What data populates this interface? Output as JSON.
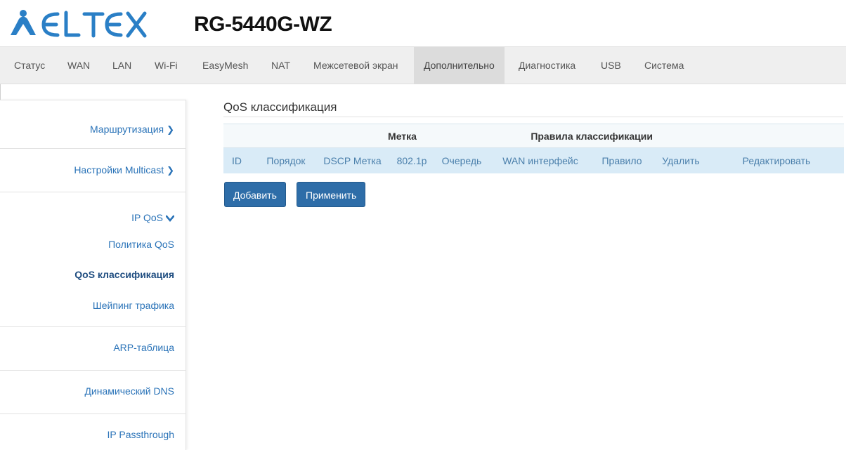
{
  "header": {
    "logo_text": "ELTEX",
    "model": "RG-5440G-WZ",
    "brand_color": "#2a7fc6"
  },
  "topnav": {
    "items": [
      "Статус",
      "WAN",
      "LAN",
      "Wi-Fi",
      "EasyMesh",
      "NAT",
      "Межсетевой экран",
      "Дополнительно",
      "Диагностика",
      "USB",
      "Система"
    ],
    "active": "Дополнительно"
  },
  "sidebar": {
    "items": [
      {
        "label": "Маршрутизация",
        "icon": "chevron-right-icon"
      },
      {
        "label": "Настройки Multicast",
        "icon": "chevron-right-icon"
      },
      {
        "label": "IP QoS",
        "icon": "chevron-down-icon"
      },
      {
        "label": "Политика QoS"
      },
      {
        "label": "QoS классификация",
        "active": true
      },
      {
        "label": "Шейпинг трафика"
      },
      {
        "label": "ARP-таблица"
      },
      {
        "label": "Динамический DNS"
      },
      {
        "label": "IP Passthrough"
      }
    ]
  },
  "main": {
    "title": "QoS классификация",
    "table": {
      "group_headers": [
        "Метка",
        "Правила классификации"
      ],
      "columns": [
        "ID",
        "Порядок",
        "DSCP Метка",
        "802.1p",
        "Очередь",
        "WAN интерфейс",
        "Правило",
        "Удалить",
        "Редактировать"
      ],
      "rows": []
    },
    "buttons": {
      "add": "Добавить",
      "apply": "Применить"
    }
  }
}
